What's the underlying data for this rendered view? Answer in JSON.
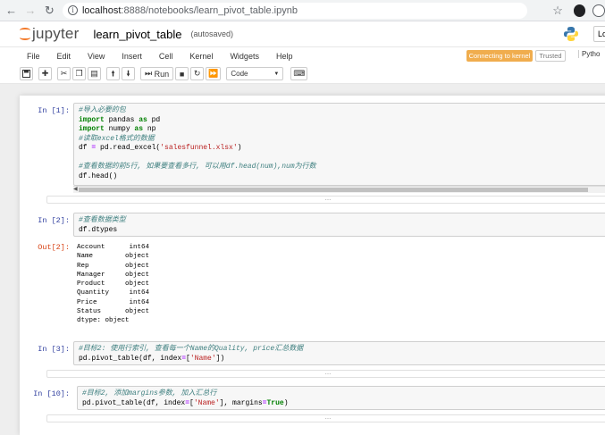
{
  "browser": {
    "url_host": "localhost",
    "url_path": ":8888/notebooks/learn_pivot_table.ipynb"
  },
  "header": {
    "logo_text": "jupyter",
    "notebook_name": "learn_pivot_table",
    "save_status": "(autosaved)",
    "login_label": "Lo"
  },
  "menu": {
    "items": [
      "File",
      "Edit",
      "View",
      "Insert",
      "Cell",
      "Kernel",
      "Widgets",
      "Help"
    ],
    "kernel_status": "Connecting to kernel",
    "trusted": "Trusted",
    "kernel_name": "Pytho"
  },
  "toolbar": {
    "run_label": "Run",
    "cell_type": "Code"
  },
  "cells": [
    {
      "prompt": "In  [1]:",
      "lines": [
        {
          "text": "#导入必要的包",
          "cls": "cm-comment"
        },
        {
          "parts": [
            {
              "text": "import",
              "cls": "cm-keyword"
            },
            {
              "text": " pandas "
            },
            {
              "text": "as",
              "cls": "cm-keyword"
            },
            {
              "text": " pd"
            }
          ]
        },
        {
          "parts": [
            {
              "text": "import",
              "cls": "cm-keyword"
            },
            {
              "text": " numpy "
            },
            {
              "text": "as",
              "cls": "cm-keyword"
            },
            {
              "text": " np"
            }
          ]
        },
        {
          "text": "#读取excel格式的数据",
          "cls": "cm-comment"
        },
        {
          "parts": [
            {
              "text": "df "
            },
            {
              "text": "=",
              "cls": "cm-op"
            },
            {
              "text": " pd.read_excel("
            },
            {
              "text": "'salesfunnel.xlsx'",
              "cls": "cm-string"
            },
            {
              "text": ")"
            }
          ]
        },
        {
          "text": ""
        },
        {
          "text": "#查看数据的前5行, 如果要查看多行, 可以用df.head(num),num为行数",
          "cls": "cm-comment"
        },
        {
          "text": "df.head()"
        }
      ]
    },
    {
      "prompt": "In  [2]:",
      "lines": [
        {
          "text": "#查看数据类型",
          "cls": "cm-comment"
        },
        {
          "text": "df.dtypes"
        }
      ],
      "out_prompt": "Out[2]:",
      "output": [
        "Account      int64",
        "Name        object",
        "Rep         object",
        "Manager     object",
        "Product     object",
        "Quantity     int64",
        "Price        int64",
        "Status      object",
        "dtype: object"
      ]
    },
    {
      "prompt": "In  [3]:",
      "lines": [
        {
          "text": "#目标2: 使用行索引, 查看每一个Name的Quality, price汇总数据",
          "cls": "cm-comment"
        },
        {
          "parts": [
            {
              "text": "pd.pivot_table(df, index"
            },
            {
              "text": "=",
              "cls": "cm-op"
            },
            {
              "text": "["
            },
            {
              "text": "'Name'",
              "cls": "cm-string"
            },
            {
              "text": "])"
            }
          ]
        }
      ]
    },
    {
      "prompt": "In  [10]:",
      "lines": [
        {
          "text": "#目标2, 添加margins参数, 加入汇总行",
          "cls": "cm-comment"
        },
        {
          "parts": [
            {
              "text": "pd.pivot_table(df, index"
            },
            {
              "text": "=",
              "cls": "cm-op"
            },
            {
              "text": "["
            },
            {
              "text": "'Name'",
              "cls": "cm-string"
            },
            {
              "text": "], margins"
            },
            {
              "text": "=",
              "cls": "cm-op"
            },
            {
              "text": "True",
              "cls": "cm-keyword"
            },
            {
              "text": ")"
            }
          ]
        }
      ]
    }
  ],
  "collapse_glyph": "...",
  "icons": {
    "back": "arrow-left-icon",
    "forward": "arrow-right-icon",
    "reload": "reload-icon",
    "info": "info-icon",
    "star": "star-icon"
  }
}
